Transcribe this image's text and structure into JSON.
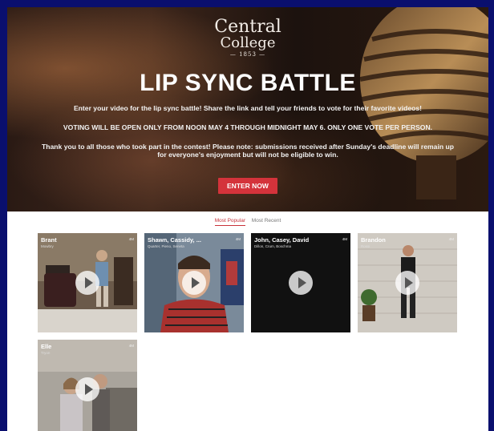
{
  "brand": {
    "line1": "Central",
    "line2": "College",
    "line3": "— 1853 —"
  },
  "hero": {
    "title": "LIP SYNC BATTLE",
    "text1": "Enter your video for the lip sync battle! Share the link and tell your friends to vote for their favorite videos!",
    "text2": "VOTING WILL BE OPEN ONLY FROM NOON MAY 4 THROUGH MIDNIGHT MAY 6. ONLY ONE VOTE PER PERSON.",
    "text3": "Thank you to all those who took part in the contest! Please note: submissions received after Sunday's deadline will remain up for everyone's enjoyment but will not be eligible to win.",
    "button": "ENTER NOW"
  },
  "tabs": [
    "Most Popular",
    "Most Recent"
  ],
  "cards": [
    {
      "name": "Brant",
      "sub": "Mowbry",
      "badge": "4M"
    },
    {
      "name": "Shawn, Cassidy, ...",
      "sub": "Quarter, Pieno, Seneta",
      "badge": "4M"
    },
    {
      "name": "John, Casey, David",
      "sub": "Dillon, Crum, Boschma",
      "badge": "4M"
    },
    {
      "name": "Brandon",
      "sub": "Rossi",
      "badge": "4M"
    },
    {
      "name": "Elle",
      "sub": "Tryon",
      "badge": "4M"
    }
  ],
  "colors": {
    "accent": "#d4333b",
    "border": "#0a0f6e"
  }
}
